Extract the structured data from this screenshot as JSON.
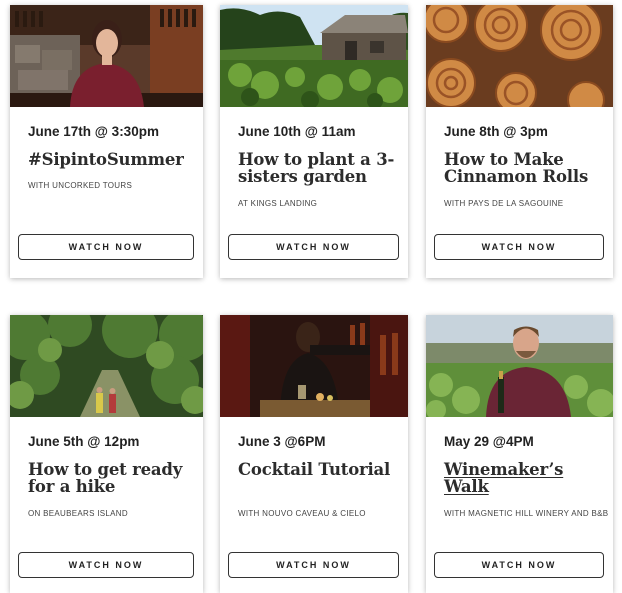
{
  "cards": [
    {
      "date": "June 17th @ 3:30pm",
      "title": "#SipintoSummer",
      "subtitle": "WITH UNCORKED TOURS",
      "button": "WATCH NOW",
      "image": "woman-in-wine-bar-photo"
    },
    {
      "date": "June 10th @ 11am",
      "title": "How to plant a 3-sisters garden",
      "subtitle": "AT KINGS LANDING",
      "button": "WATCH NOW",
      "image": "barn-and-garden-photo"
    },
    {
      "date": "June 8th @ 3pm",
      "title": "How to Make Cinnamon Rolls",
      "subtitle": "WITH PAYS DE LA SAGOUINE",
      "button": "WATCH NOW",
      "image": "cinnamon-rolls-photo"
    },
    {
      "date": "June 5th @ 12pm",
      "title": "How to get ready for a hike",
      "subtitle": "ON BEAUBEARS ISLAND",
      "button": "WATCH NOW",
      "image": "forest-trail-hikers-photo"
    },
    {
      "date": "June 3 @6PM",
      "title": "Cocktail Tutorial",
      "subtitle": "WITH NOUVO CAVEAU & CIELO",
      "button": "WATCH NOW",
      "image": "bartender-cocktail-photo"
    },
    {
      "date": "May 29 @4PM",
      "title": "Winemaker’s Walk",
      "subtitle": "WITH MAGNETIC HILL WINERY AND B&B",
      "button": "WATCH NOW",
      "image": "winemaker-vineyard-photo"
    }
  ]
}
